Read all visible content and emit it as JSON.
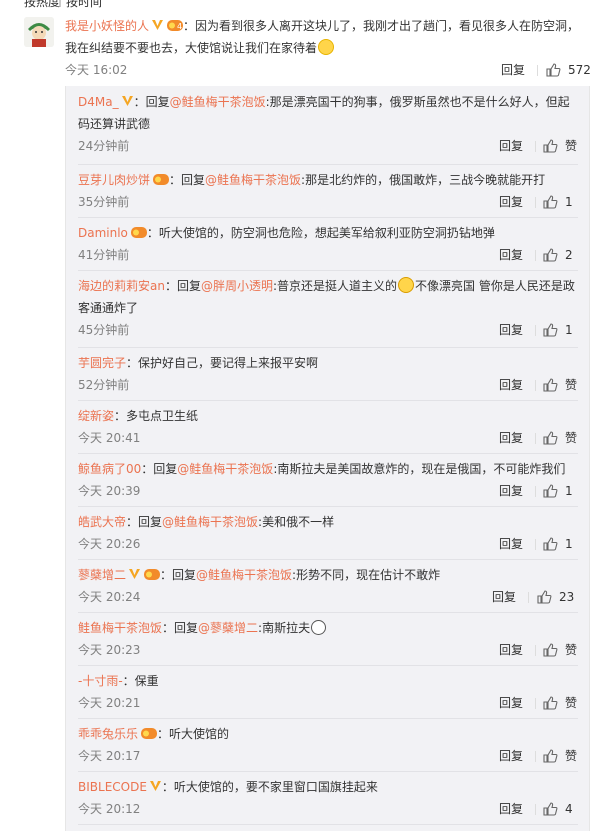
{
  "topbar": {
    "tab1": "按热度",
    "sep": "|",
    "tab2": "按时间"
  },
  "main_comment": {
    "user": "我是小妖怪的人",
    "text": "：因为看到很多人离开这块儿了，我刚才出了趟门，看见很多人在防空洞，我在纠结要不要也去，大使馆说让我们在家待着",
    "time": "今天 16:02",
    "reply_label": "回复",
    "likes": "572"
  },
  "replies": [
    {
      "user": "D4Ma_",
      "prefix": "：回复",
      "at": "@鲑鱼梅干茶泡饭",
      "text": ":那是漂亮国干的狗事，俄罗斯虽然也不是什么好人，但起码还算讲武德",
      "time": "24分钟前",
      "reply_label": "回复",
      "likes": "赞"
    },
    {
      "user": "豆芽儿肉炒饼",
      "prefix": "：回复",
      "at": "@鲑鱼梅干茶泡饭",
      "text": ":那是北约炸的，俄国敢炸，三战今晚就能开打",
      "time": "35分钟前",
      "reply_label": "回复",
      "likes": "1"
    },
    {
      "user": "Daminlo",
      "prefix": "",
      "at": "",
      "text": "：听大使馆的，防空洞也危险，想起美军给叙利亚防空洞扔钻地弹",
      "time": "41分钟前",
      "reply_label": "回复",
      "likes": "2"
    },
    {
      "user": "海边的莉莉安an",
      "prefix": "：回复",
      "at": "@胖周小透明",
      "text": ":普京还是挺人道主义的",
      "text2": "不像漂亮国 管你是人民还是政客通通炸了",
      "time": "45分钟前",
      "reply_label": "回复",
      "likes": "1"
    },
    {
      "user": "芋圆完子",
      "prefix": "",
      "at": "",
      "text": "：保护好自己，要记得上来报平安啊",
      "time": "52分钟前",
      "reply_label": "回复",
      "likes": "赞"
    },
    {
      "user": "绽新姿",
      "prefix": "",
      "at": "",
      "text": "：多屯点卫生纸",
      "time": "今天 20:41",
      "reply_label": "回复",
      "likes": "赞"
    },
    {
      "user": "鲸鱼病了00",
      "prefix": "：回复",
      "at": "@鲑鱼梅干茶泡饭",
      "text": ":南斯拉夫是美国故意炸的，现在是俄国，不可能炸我们",
      "time": "今天 20:39",
      "reply_label": "回复",
      "likes": "1"
    },
    {
      "user": "皓武大帝",
      "prefix": "：回复",
      "at": "@鲑鱼梅干茶泡饭",
      "text": ":美和俄不一样",
      "time": "今天 20:26",
      "reply_label": "回复",
      "likes": "1"
    },
    {
      "user": "蓼蘖增二",
      "prefix": "：回复",
      "at": "@鲑鱼梅干茶泡饭",
      "text": ":形势不同，现在估计不敢炸",
      "time": "今天 20:24",
      "reply_label": "回复",
      "likes": "23"
    },
    {
      "user": "鲑鱼梅干茶泡饭",
      "prefix": "：回复",
      "at": "@蓼蘖增二",
      "text": ":南斯拉夫",
      "time": "今天 20:23",
      "reply_label": "回复",
      "likes": "赞"
    },
    {
      "user": "-十寸雨-",
      "prefix": "",
      "at": "",
      "text": "：保重",
      "time": "今天 20:21",
      "reply_label": "回复",
      "likes": "赞"
    },
    {
      "user": "乖乖兔乐乐",
      "prefix": "",
      "at": "",
      "text": "：听大使馆的",
      "time": "今天 20:17",
      "reply_label": "回复",
      "likes": "赞"
    },
    {
      "user": "BIBLECODE",
      "prefix": "",
      "at": "",
      "text": "：听大使馆的，要不家里窗口国旗挂起来",
      "time": "今天 20:12",
      "reply_label": "回复",
      "likes": "4"
    }
  ],
  "colors": {
    "username": "#eb7350",
    "reply_bg": "#f2f2f5",
    "meta": "#808080"
  }
}
